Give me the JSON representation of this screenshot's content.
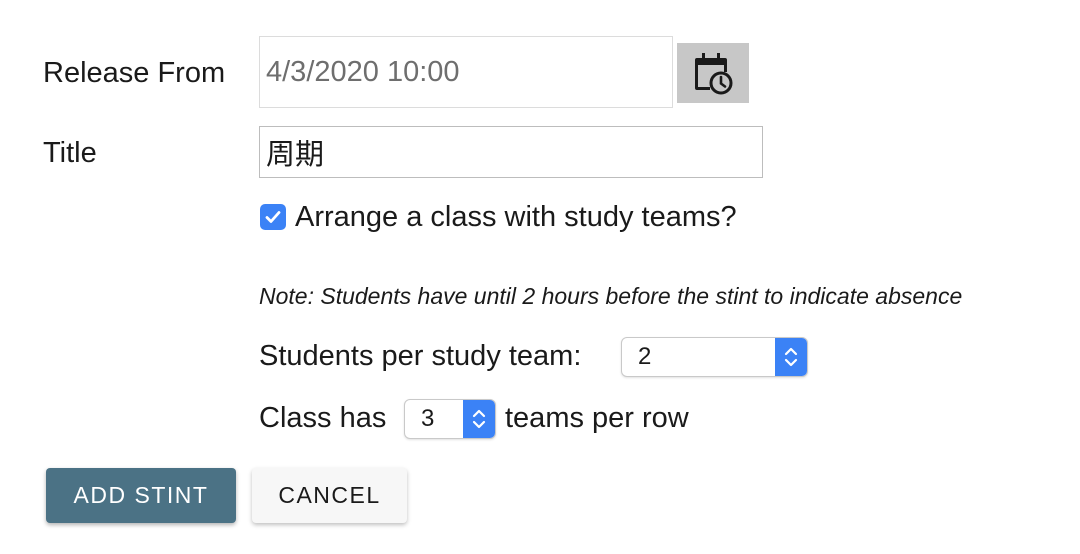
{
  "form": {
    "release_label": "Release From",
    "release_placeholder": "4/3/2020 10:00",
    "title_label": "Title",
    "title_value": "周期",
    "teams_checkbox_label": "Arrange a class with study teams?",
    "teams_checkbox_checked": true,
    "note": "Note: Students have until 2 hours before the stint to indicate absence",
    "per_team_label": "Students per study team:",
    "per_team_value": "2",
    "class_has_label": "Class has",
    "per_row_value": "3",
    "teams_per_row_label": "teams per row"
  },
  "buttons": {
    "add_label": "ADD STINT",
    "cancel_label": "CANCEL"
  },
  "icons": {
    "calendar": "calendar-clock-icon",
    "check": "checkmark-icon",
    "select_arrows": "chevron-up-down-icon"
  },
  "colors": {
    "primary_button": "#4b7285",
    "accent": "#3b82f6",
    "calendar_button_bg": "#c7c7c7"
  }
}
